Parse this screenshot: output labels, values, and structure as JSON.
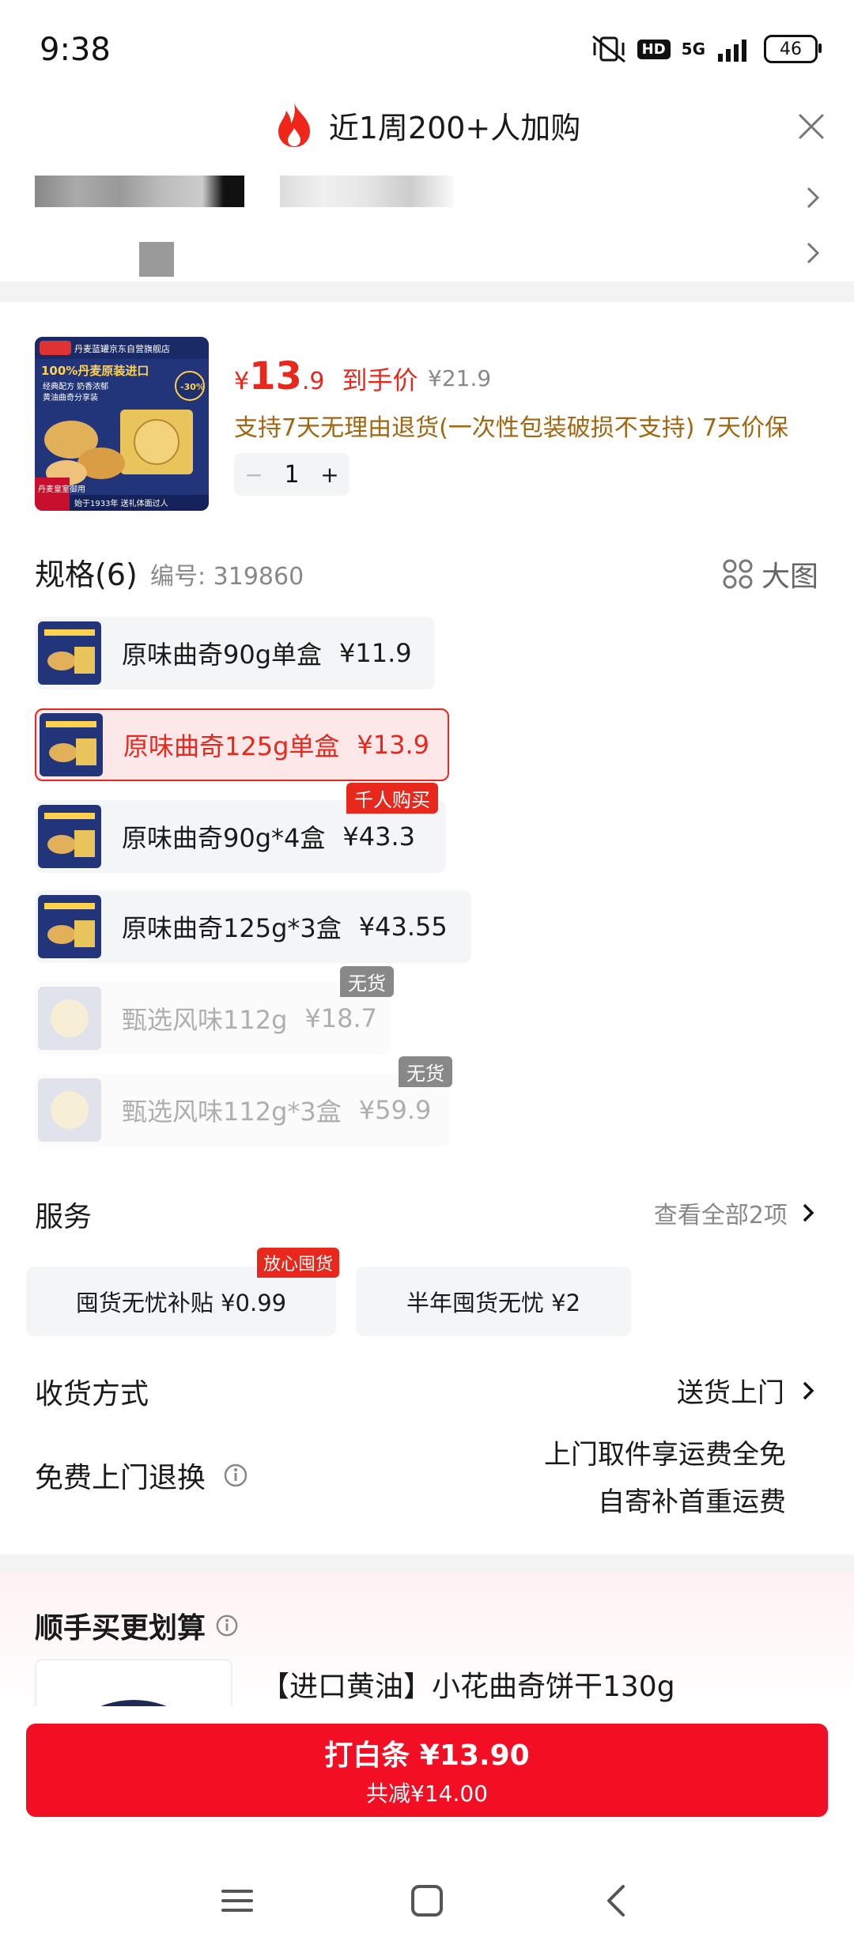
{
  "status_bar": {
    "time": "9:38",
    "hd": "HD",
    "network": "5G",
    "battery": "46"
  },
  "header": {
    "title": "近1周200+人加购"
  },
  "product": {
    "price_yen": "¥",
    "price_int": "13",
    "price_dec": ".9",
    "price_label": "到手价",
    "original_price": "¥21.9",
    "policy": "支持7天无理由退货(一次性包装破损不支持) 7天价保",
    "quantity": "1",
    "minus": "−",
    "plus": "+",
    "image_text": {
      "shop": "丹麦蓝罐京东自营旗舰店",
      "headline": "100%丹麦原装进口",
      "sub1": "经典配方 奶香浓郁",
      "sub2": "黄油曲奇分享装",
      "discount": "-30%",
      "badge": "丹麦皇室御用",
      "footer": "始于1933年 送礼体面过人"
    }
  },
  "spec": {
    "title": "规格(6)",
    "code_label": "编号: 319860",
    "big_image_label": "大图",
    "variants": [
      {
        "name": "原味曲奇90g单盒",
        "price": "¥11.9",
        "state": "normal"
      },
      {
        "name": "原味曲奇125g单盒",
        "price": "¥13.9",
        "state": "selected"
      },
      {
        "name": "原味曲奇90g*4盒",
        "price": "¥43.3",
        "state": "normal",
        "badge": "千人购买"
      },
      {
        "name": "原味曲奇125g*3盒",
        "price": "¥43.55",
        "state": "normal"
      },
      {
        "name": "甄选风味112g",
        "price": "¥18.7",
        "state": "disabled",
        "badge": "无货"
      },
      {
        "name": "甄选风味112g*3盒",
        "price": "¥59.9",
        "state": "disabled",
        "badge": "无货"
      }
    ]
  },
  "service": {
    "title": "服务",
    "view_all": "查看全部2项",
    "cards": [
      {
        "label": "囤货无忧补贴 ¥0.99",
        "badge": "放心囤货"
      },
      {
        "label": "半年囤货无忧 ¥2"
      }
    ]
  },
  "delivery": {
    "label": "收货方式",
    "value": "送货上门"
  },
  "free_return": {
    "label": "免费上门退换",
    "line1": "上门取件享运费全免",
    "line2": "自寄补首重运费"
  },
  "recommend": {
    "title": "顺手买更划算",
    "item_name": "【进口黄油】小花曲奇饼干130g"
  },
  "buy_button": {
    "main": "打白条 ¥13.90",
    "sub": "共减¥14.00"
  },
  "colors": {
    "accent": "#e8281d",
    "button": "#f20e23",
    "policy_text": "#a06611"
  }
}
